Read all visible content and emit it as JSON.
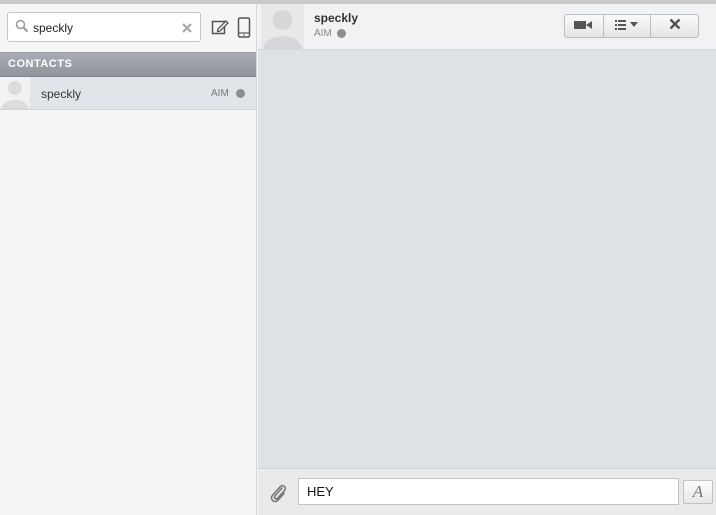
{
  "sidebar": {
    "search": {
      "value": "speckly",
      "placeholder": ""
    },
    "contacts_header": "CONTACTS",
    "contacts": [
      {
        "name": "speckly",
        "service": "AIM",
        "status": "offline"
      }
    ]
  },
  "chat": {
    "contact_name": "speckly",
    "service": "AIM",
    "status": "offline",
    "message_input": "HEY",
    "font_button": "A"
  },
  "icons": {
    "search": "search-icon",
    "clear": "clear-icon",
    "compose": "compose-icon",
    "mobile": "mobile-icon",
    "video": "video-camera-icon",
    "menu": "list-menu-icon",
    "close": "close-icon",
    "attach": "paperclip-icon"
  },
  "colors": {
    "header_bar": "#969ba2",
    "selected_row": "#e1e5e9",
    "chat_bg": "#dde2e6",
    "status_offline": "#8e8e8e"
  }
}
